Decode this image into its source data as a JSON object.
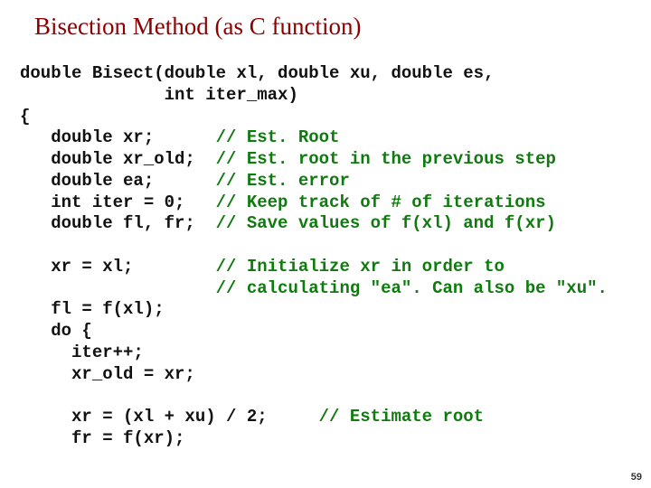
{
  "title": "Bisection Method (as C function)",
  "code": {
    "l01a": "double Bisect(double xl, double xu, double es,",
    "l01b": "              int iter_max)",
    "l02": "{",
    "l03a": "   double xr;      ",
    "l03c": "// Est. Root",
    "l04a": "   double xr_old;  ",
    "l04c": "// Est. root in the previous step",
    "l05a": "   double ea;      ",
    "l05c": "// Est. error",
    "l06a": "   int iter = 0;   ",
    "l06c": "// Keep track of # of iterations",
    "l07a": "   double fl, fr;  ",
    "l07c": "// Save values of f(xl) and f(xr)",
    "blank1": "",
    "l08a": "   xr = xl;        ",
    "l08c": "// Initialize xr in order to",
    "l09a": "                   ",
    "l09c": "// calculating \"ea\". Can also be \"xu\".",
    "l10": "   fl = f(xl);",
    "l11": "   do {",
    "l12": "     iter++;",
    "l13": "     xr_old = xr;",
    "blank2": "",
    "l14a": "     xr = (xl + xu) / 2;     ",
    "l14c": "// Estimate root",
    "l15": "     fr = f(xr);"
  },
  "page_number": "59"
}
